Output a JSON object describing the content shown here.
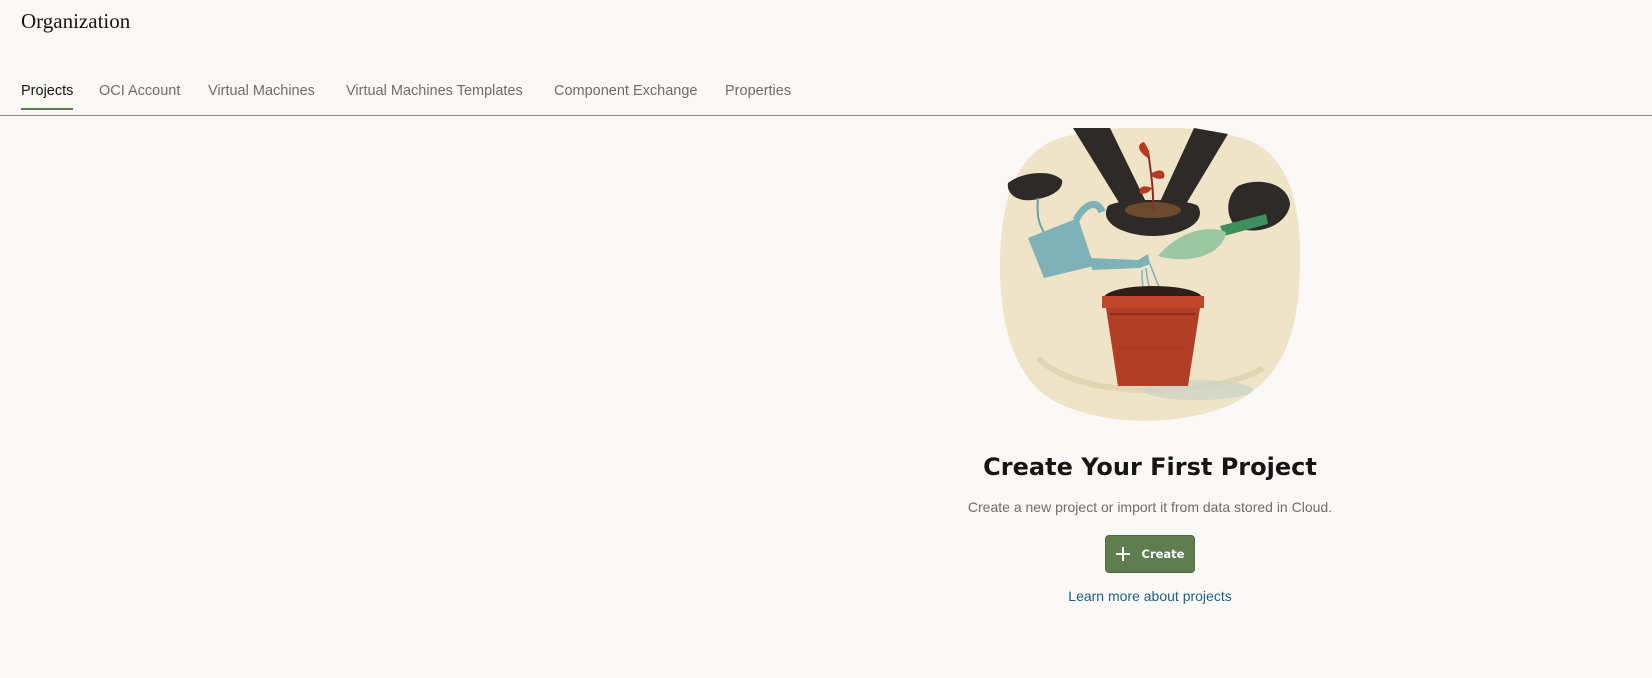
{
  "page": {
    "title": "Organization"
  },
  "tabs": [
    {
      "label": "Projects",
      "active": true
    },
    {
      "label": "OCI Account",
      "active": false
    },
    {
      "label": "Virtual Machines",
      "active": false
    },
    {
      "label": "Virtual Machines Templates",
      "active": false
    },
    {
      "label": "Component Exchange",
      "active": false
    },
    {
      "label": "Properties",
      "active": false
    }
  ],
  "empty_state": {
    "illustration_icon": "planting-illustration",
    "title": "Create Your First Project",
    "description": "Create a new project or import it from data stored in Cloud.",
    "create_button": {
      "label": "Create",
      "icon": "plus-icon"
    },
    "learn_more_link": "Learn more about projects"
  },
  "colors": {
    "accent": "#5f7d4f",
    "link": "#1d5f89",
    "background": "#fbf9f8",
    "text_primary": "#161513",
    "text_secondary": "#6f6c68"
  }
}
